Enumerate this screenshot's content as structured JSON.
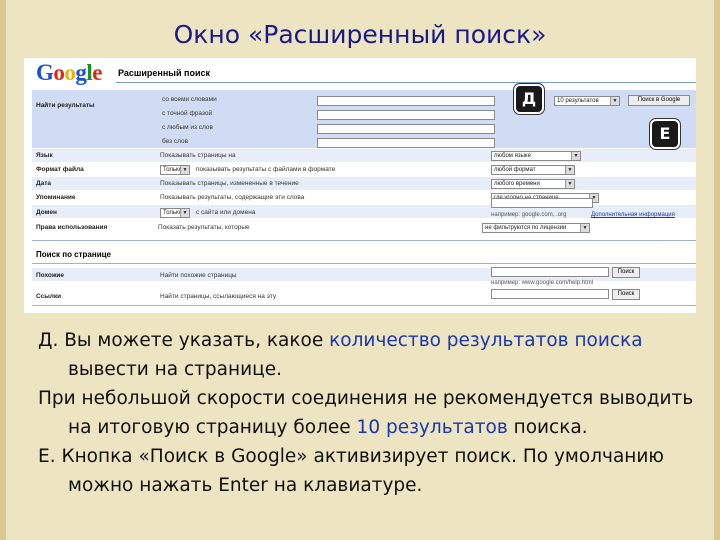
{
  "slide": {
    "title": "Окно «Расширенный поиск»"
  },
  "google_page": {
    "logo": "Google",
    "heading": "Расширенный поиск",
    "find_results_label": "Найти результаты",
    "query_rows": [
      "со всеми словами",
      "с точной фразой",
      "с любым из слов",
      "без слов"
    ],
    "results_select": "10 результатов",
    "search_button": "Поиск в Google",
    "options": [
      {
        "label": "Язык",
        "text": "Показывать страницы на",
        "value": "любом языке"
      },
      {
        "label": "Формат файла",
        "text": "показывать результаты с файлами в формате",
        "prefix": "Только",
        "value": "любой формат"
      },
      {
        "label": "Дата",
        "text": "Показывать страницы, измененные в течение",
        "value": "любого времени"
      },
      {
        "label": "Упоминание",
        "text": "Показывать результаты, содержащие эти слова",
        "value": "где угодно на странице"
      },
      {
        "label": "Домен",
        "text": "с сайта или домена",
        "prefix": "Только",
        "value": "",
        "hint": "например: google.com, .org",
        "hint_link": "Дополнительная информация"
      },
      {
        "label": "Права использования",
        "text": "Показать результаты, которые",
        "value": "не фильтруются по лицензии"
      }
    ],
    "page_search": {
      "heading": "Поиск по странице",
      "similar_label": "Похожие",
      "similar_text": "Найти похожие страницы",
      "links_label": "Ссылки",
      "links_text": "Найти страницы, ссылающиеся на эту",
      "button": "Поиск",
      "example": "например: www.google.com/help.html"
    }
  },
  "markers": {
    "d": "Д",
    "e": "Е"
  },
  "description": {
    "p1_prefix": "Д. Вы можете указать, какое ",
    "p1_hl": "количество результатов поиска",
    "p1_suffix": " вывести на странице.",
    "p2_prefix": "При небольшой скорости соединения не рекомендуется выводить на итоговую страницу более ",
    "p2_hl": "10 результатов",
    "p2_suffix": " поиска.",
    "p3": "Е. Кнопка «Поиск в Google» активизирует поиск. По умолчанию можно нажать Enter на клавиатуре."
  }
}
